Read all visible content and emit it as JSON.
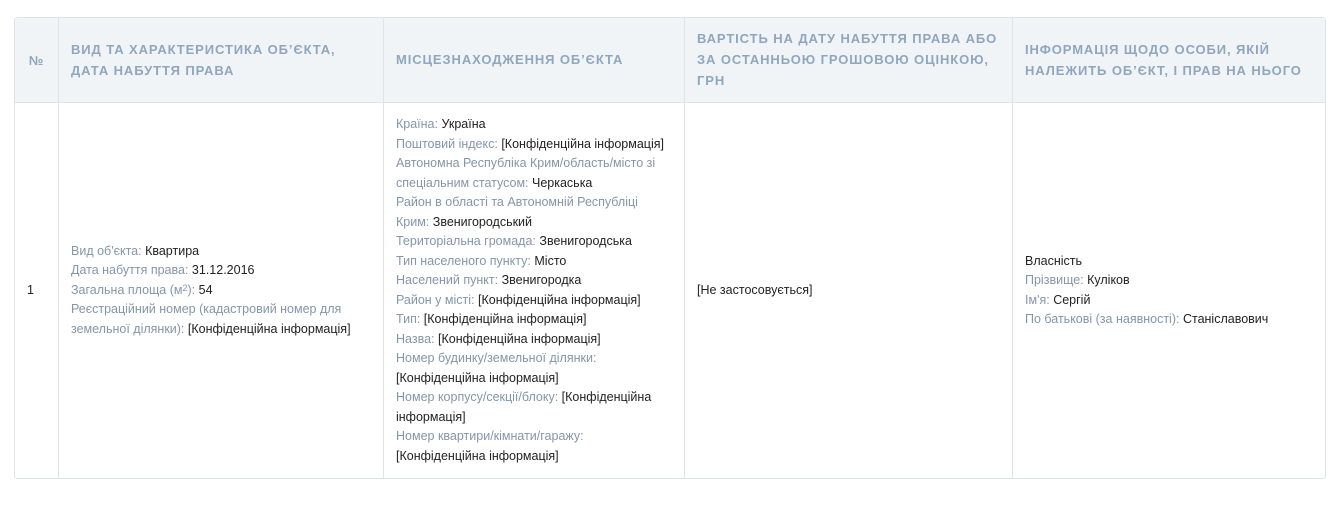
{
  "headers": {
    "num": "№",
    "object": "ВИД ТА ХАРАКТЕРИСТИКА ОБ’ЄКТА, ДАТА НАБУТТЯ ПРАВА",
    "location": "МІСЦЕЗНАХОДЖЕННЯ ОБ’ЄКТА",
    "value": "ВАРТІСТЬ НА ДАТУ НАБУТТЯ ПРАВА АБО ЗА ОСТАННЬОЮ ГРОШОВОЮ ОЦІНКОЮ, ГРН",
    "owner": "ІНФОРМАЦІЯ ЩОДО ОСОБИ, ЯКІЙ НАЛЕЖИТЬ ОБ’ЄКТ, І ПРАВ НА НЬОГО"
  },
  "row": {
    "num": "1",
    "object": {
      "type_label": "Вид об'єкта:",
      "type_value": "Квартира",
      "date_label": "Дата набуття права:",
      "date_value": "31.12.2016",
      "area_label_pre": "Загальна площа (м",
      "area_label_sup": "2",
      "area_label_post": "):",
      "area_value": "54",
      "reg_label": "Реєстраційний номер (кадастровий номер для земельної ділянки):",
      "reg_value": "[Конфіденційна інформація]"
    },
    "location": {
      "country_label": "Країна:",
      "country_value": "Україна",
      "postal_label": "Поштовий індекс:",
      "postal_value": "[Конфіденційна інформація]",
      "region_label": "Автономна Республіка Крим/область/місто зі спеціальним статусом:",
      "region_value": "Черкаська",
      "district_label": "Район в області та Автономній Республіці Крим:",
      "district_value": "Звенигородський",
      "community_label": "Територіальна громада:",
      "community_value": "Звенигородська",
      "settlement_type_label": "Тип населеного пункту:",
      "settlement_type_value": "Місто",
      "settlement_label": "Населений пункт:",
      "settlement_value": "Звенигородка",
      "city_district_label": "Район у місті:",
      "city_district_value": "[Конфіденційна інформація]",
      "street_type_label": "Тип:",
      "street_type_value": "[Конфіденційна інформація]",
      "street_name_label": "Назва:",
      "street_name_value": "[Конфіденційна інформація]",
      "building_label": "Номер будинку/земельної ділянки:",
      "building_value": "[Конфіденційна інформація]",
      "block_label": "Номер корпусу/секції/блоку:",
      "block_value": "[Конфіденційна інформація]",
      "apartment_label": "Номер квартири/кімнати/гаражу:",
      "apartment_value": "[Конфіденційна інформація]"
    },
    "value": "[Не застосовується]",
    "owner": {
      "right_type": "Власність",
      "surname_label": "Прізвище:",
      "surname_value": "Куліков",
      "name_label": "Ім'я:",
      "name_value": "Сергій",
      "patronymic_label": "По батькові (за наявності):",
      "patronymic_value": "Станіславович"
    }
  }
}
